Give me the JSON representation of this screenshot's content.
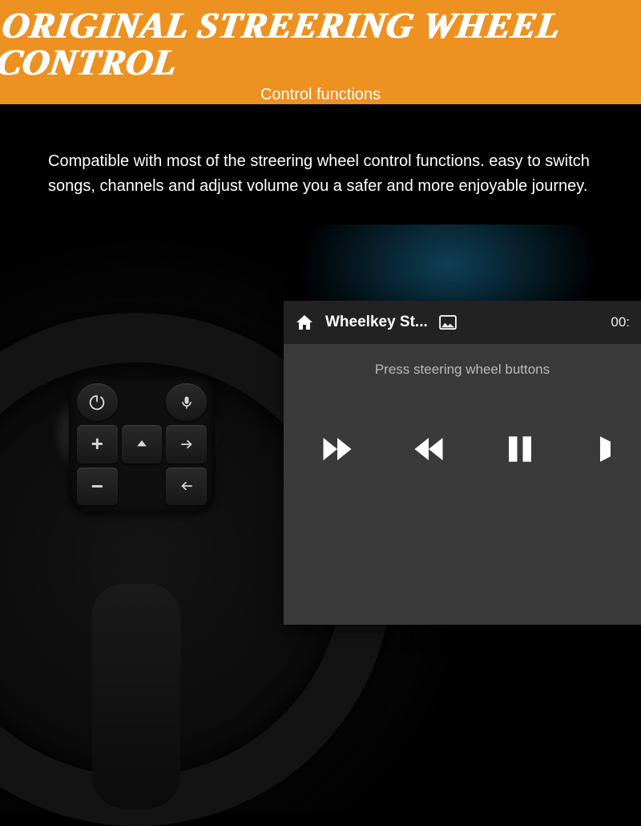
{
  "header": {
    "title": "ORIGINAL STREERING WHEEL CONTROL",
    "subtitle": "Control functions"
  },
  "description": "Compatible with most of the streering wheel control functions. easy to switch songs, channels and adjust volume you a safer and more enjoyable journey.",
  "wheel_buttons": {
    "power": "⏻",
    "voice": "voice",
    "up": "▲",
    "plus": "+",
    "minus": "−",
    "left": "←",
    "right": "→"
  },
  "panel": {
    "app_title": "Wheelkey St...",
    "time": "00:",
    "hint": "Press steering wheel buttons",
    "controls": [
      "forward",
      "rewind",
      "pause",
      "play"
    ]
  }
}
